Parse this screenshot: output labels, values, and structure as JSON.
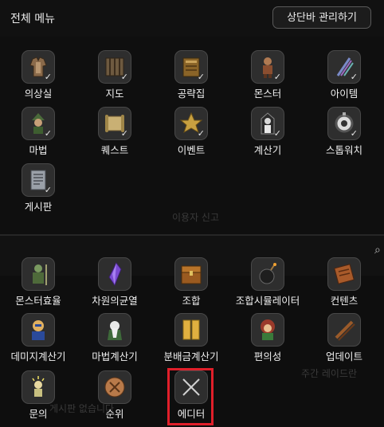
{
  "header": {
    "title": "전체 메뉴",
    "manage_button": "상단바 관리하기"
  },
  "background_text": {
    "report": "이용자 신고",
    "weekly_raid": "주간 레이드란",
    "notice": "게시판 없습니다"
  },
  "section1_items": [
    {
      "icon": "wardrobe-icon",
      "label": "의상실"
    },
    {
      "icon": "map-icon",
      "label": "지도"
    },
    {
      "icon": "guidebook-icon",
      "label": "공략집"
    },
    {
      "icon": "monster-icon",
      "label": "몬스터"
    },
    {
      "icon": "item-icon",
      "label": "아이템"
    },
    {
      "icon": "magic-icon",
      "label": "마법"
    },
    {
      "icon": "quest-scroll-icon",
      "label": "퀘스트"
    },
    {
      "icon": "event-star-icon",
      "label": "이벤트"
    },
    {
      "icon": "calculator-icon",
      "label": "계산기"
    },
    {
      "icon": "stopwatch-icon",
      "label": "스톱워치"
    },
    {
      "icon": "board-icon",
      "label": "게시판"
    }
  ],
  "section2_items": [
    {
      "icon": "monster-efficiency-icon",
      "label": "몬스터효율"
    },
    {
      "icon": "crystal-icon",
      "label": "차원의균열"
    },
    {
      "icon": "chest-icon",
      "label": "조합"
    },
    {
      "icon": "bomb-icon",
      "label": "조합시뮬레이터"
    },
    {
      "icon": "contents-scroll-icon",
      "label": "컨텐츠"
    },
    {
      "icon": "damage-calc-icon",
      "label": "데미지계산기"
    },
    {
      "icon": "magic-calc-icon",
      "label": "마법계산기"
    },
    {
      "icon": "cash-split-icon",
      "label": "분배금계산기"
    },
    {
      "icon": "convenience-icon",
      "label": "편의성"
    },
    {
      "icon": "update-icon",
      "label": "업데이트"
    },
    {
      "icon": "inquiry-icon",
      "label": "문의"
    },
    {
      "icon": "ranking-icon",
      "label": "순위"
    },
    {
      "icon": "editor-swords-icon",
      "label": "에디터"
    }
  ],
  "checkmark": "✓"
}
